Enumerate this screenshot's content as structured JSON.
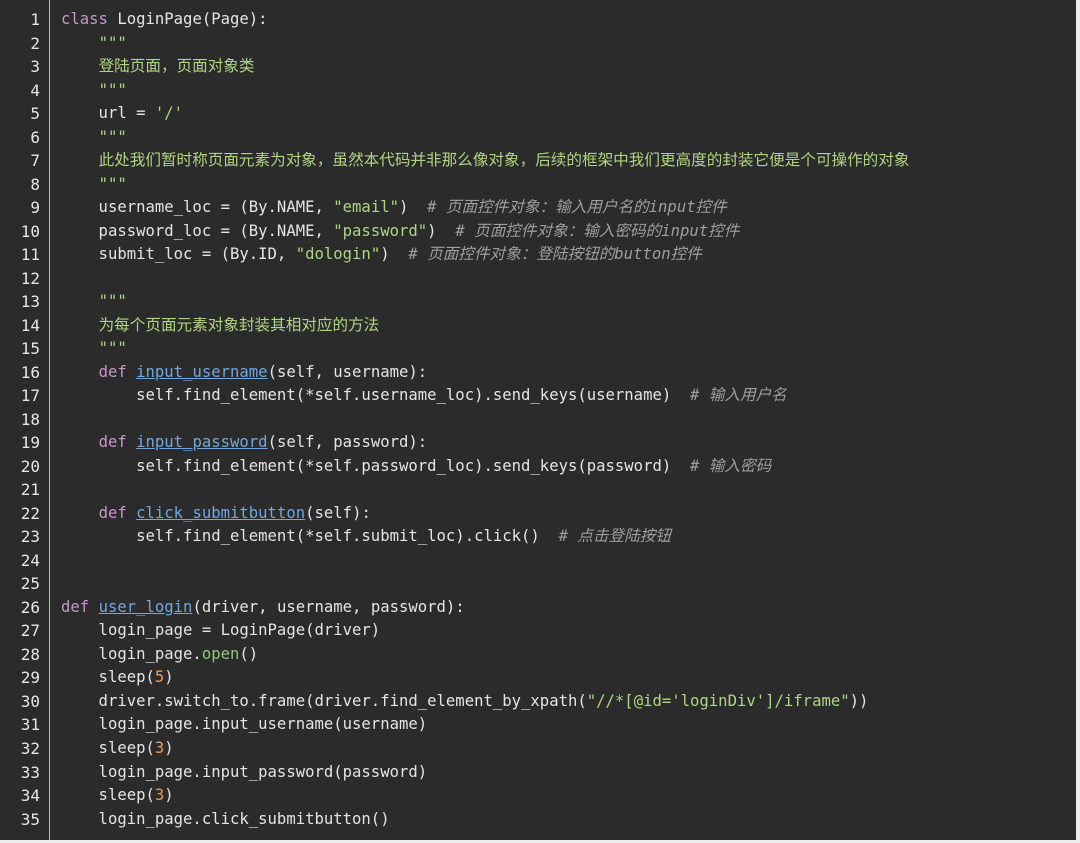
{
  "editor": {
    "colors": {
      "page_background": "#ececec",
      "background": "#2b2b2b",
      "text": "#e4e4e4",
      "line_number": "#e6e6e6",
      "gutter_divider": "#b5b5b5"
    },
    "syntax_colors": {
      "keyword": "#c996cb",
      "function": "#72a6dc",
      "string": "#aed581",
      "number": "#e69d5c",
      "comment": "#9e9e9e",
      "builtin": "#8fca7c"
    },
    "lines": [
      {
        "number": "1",
        "tokens": [
          {
            "text": "class",
            "color": "#c996cb"
          },
          {
            "text": " LoginPage(Page):"
          }
        ]
      },
      {
        "number": "2",
        "tokens": [
          {
            "text": "    "
          },
          {
            "text": "\"\"\"",
            "color": "#aed581"
          }
        ]
      },
      {
        "number": "3",
        "tokens": [
          {
            "text": "    "
          },
          {
            "text": "登陆页面，页面对象类",
            "color": "#aed581"
          }
        ]
      },
      {
        "number": "4",
        "tokens": [
          {
            "text": "    "
          },
          {
            "text": "\"\"\"",
            "color": "#aed581"
          }
        ]
      },
      {
        "number": "5",
        "tokens": [
          {
            "text": "    url = "
          },
          {
            "text": "'/'",
            "color": "#aed581"
          }
        ]
      },
      {
        "number": "6",
        "tokens": [
          {
            "text": "    "
          },
          {
            "text": "\"\"\"",
            "color": "#aed581"
          }
        ]
      },
      {
        "number": "7",
        "tokens": [
          {
            "text": "    "
          },
          {
            "text": "此处我们暂时称页面元素为对象，虽然本代码并非那么像对象，后续的框架中我们更高度的封装它便是个可操作的对象",
            "color": "#aed581"
          }
        ]
      },
      {
        "number": "8",
        "tokens": [
          {
            "text": "    "
          },
          {
            "text": "\"\"\"",
            "color": "#aed581"
          }
        ]
      },
      {
        "number": "9",
        "tokens": [
          {
            "text": "    username_loc = (By.NAME, "
          },
          {
            "text": "\"email\"",
            "color": "#aed581"
          },
          {
            "text": ")  "
          },
          {
            "text": "# 页面控件对象：输入用户名的input控件",
            "color": "#9e9e9e",
            "italic": true
          }
        ]
      },
      {
        "number": "10",
        "tokens": [
          {
            "text": "    password_loc = (By.NAME, "
          },
          {
            "text": "\"password\"",
            "color": "#aed581"
          },
          {
            "text": ")  "
          },
          {
            "text": "# 页面控件对象：输入密码的input控件",
            "color": "#9e9e9e",
            "italic": true
          }
        ]
      },
      {
        "number": "11",
        "tokens": [
          {
            "text": "    submit_loc = (By.ID, "
          },
          {
            "text": "\"dologin\"",
            "color": "#aed581"
          },
          {
            "text": ")  "
          },
          {
            "text": "# 页面控件对象：登陆按钮的button控件",
            "color": "#9e9e9e",
            "italic": true
          }
        ]
      },
      {
        "number": "12",
        "tokens": []
      },
      {
        "number": "13",
        "tokens": [
          {
            "text": "    "
          },
          {
            "text": "\"\"\"",
            "color": "#aed581"
          }
        ]
      },
      {
        "number": "14",
        "tokens": [
          {
            "text": "    "
          },
          {
            "text": "为每个页面元素对象封装其相对应的方法",
            "color": "#aed581"
          }
        ]
      },
      {
        "number": "15",
        "tokens": [
          {
            "text": "    "
          },
          {
            "text": "\"\"\"",
            "color": "#aed581"
          }
        ]
      },
      {
        "number": "16",
        "tokens": [
          {
            "text": "    "
          },
          {
            "text": "def",
            "color": "#c996cb"
          },
          {
            "text": " "
          },
          {
            "text": "input_username",
            "color": "#72a6dc",
            "underline": true
          },
          {
            "text": "(self, username):"
          }
        ]
      },
      {
        "number": "17",
        "tokens": [
          {
            "text": "        self.find_element(*self.username_loc).send_keys(username)  "
          },
          {
            "text": "# 输入用户名",
            "color": "#9e9e9e",
            "italic": true
          }
        ]
      },
      {
        "number": "18",
        "tokens": []
      },
      {
        "number": "19",
        "tokens": [
          {
            "text": "    "
          },
          {
            "text": "def",
            "color": "#c996cb"
          },
          {
            "text": " "
          },
          {
            "text": "input_password",
            "color": "#72a6dc",
            "underline": true
          },
          {
            "text": "(self, password):"
          }
        ]
      },
      {
        "number": "20",
        "tokens": [
          {
            "text": "        self.find_element(*self.password_loc).send_keys(password)  "
          },
          {
            "text": "# 输入密码",
            "color": "#9e9e9e",
            "italic": true
          }
        ]
      },
      {
        "number": "21",
        "tokens": []
      },
      {
        "number": "22",
        "tokens": [
          {
            "text": "    "
          },
          {
            "text": "def",
            "color": "#c996cb"
          },
          {
            "text": " "
          },
          {
            "text": "click_submitbutton",
            "color": "#72a6dc",
            "underline": true
          },
          {
            "text": "(self):"
          }
        ]
      },
      {
        "number": "23",
        "tokens": [
          {
            "text": "        self.find_element(*self.submit_loc).click()  "
          },
          {
            "text": "# 点击登陆按钮",
            "color": "#9e9e9e",
            "italic": true
          }
        ]
      },
      {
        "number": "24",
        "tokens": []
      },
      {
        "number": "25",
        "tokens": []
      },
      {
        "number": "26",
        "tokens": [
          {
            "text": "def",
            "color": "#c996cb"
          },
          {
            "text": " "
          },
          {
            "text": "user_login",
            "color": "#72a6dc",
            "underline": true
          },
          {
            "text": "(driver, username, password):"
          }
        ]
      },
      {
        "number": "27",
        "tokens": [
          {
            "text": "    login_page = LoginPage(driver)"
          }
        ]
      },
      {
        "number": "28",
        "tokens": [
          {
            "text": "    login_page."
          },
          {
            "text": "open",
            "color": "#8fca7c"
          },
          {
            "text": "()"
          }
        ]
      },
      {
        "number": "29",
        "tokens": [
          {
            "text": "    sleep("
          },
          {
            "text": "5",
            "color": "#e69d5c"
          },
          {
            "text": ")"
          }
        ]
      },
      {
        "number": "30",
        "tokens": [
          {
            "text": "    driver.switch_to.frame(driver.find_element_by_xpath("
          },
          {
            "text": "\"//*[@id='loginDiv']/iframe\"",
            "color": "#aed581"
          },
          {
            "text": "))"
          }
        ]
      },
      {
        "number": "31",
        "tokens": [
          {
            "text": "    login_page.input_username(username)"
          }
        ]
      },
      {
        "number": "32",
        "tokens": [
          {
            "text": "    sleep("
          },
          {
            "text": "3",
            "color": "#e69d5c"
          },
          {
            "text": ")"
          }
        ]
      },
      {
        "number": "33",
        "tokens": [
          {
            "text": "    login_page.input_password(password)"
          }
        ]
      },
      {
        "number": "34",
        "tokens": [
          {
            "text": "    sleep("
          },
          {
            "text": "3",
            "color": "#e69d5c"
          },
          {
            "text": ")"
          }
        ]
      },
      {
        "number": "35",
        "tokens": [
          {
            "text": "    login_page.click_submitbutton()"
          }
        ]
      }
    ]
  }
}
